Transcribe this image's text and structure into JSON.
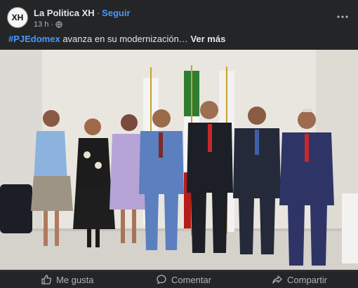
{
  "post": {
    "page_name": "La Politica XH",
    "avatar_text": "XH",
    "separator": "·",
    "follow_label": "Seguir",
    "time": "13 h",
    "time_separator": "·",
    "caption": {
      "hashtag": "#PJEdomex",
      "text": " avanza en su modernización…",
      "see_more": "Ver más"
    },
    "photo": {
      "icon": "group-photo"
    }
  },
  "actions": {
    "like_label": "Me gusta",
    "comment_label": "Comentar",
    "share_label": "Compartir"
  }
}
